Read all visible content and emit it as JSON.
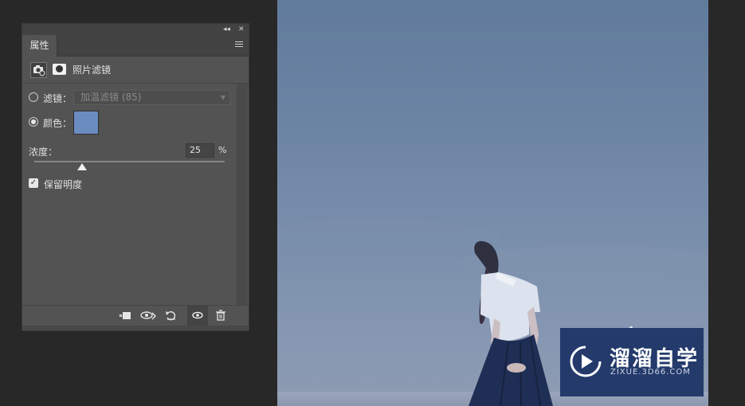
{
  "panel": {
    "tab_label": "属性",
    "header_title": "照片滤镜",
    "filter_label": "滤镜：",
    "filter_value": "加温滤镜 (85)",
    "color_label": "颜色：",
    "color_value": "#6a8cc0",
    "density_label": "浓度：",
    "density_value": "25",
    "density_unit": "%",
    "density_fraction": 0.25,
    "preserve_label": "保留明度",
    "preserve_checked": true,
    "selected_option": "color"
  },
  "icons": {
    "collapse": "double-left-arrow-icon",
    "close": "close-icon",
    "menu": "panel-menu-icon",
    "camera": "camera-adjustment-icon",
    "mask": "mask-icon",
    "clip": "clip-to-layer-icon",
    "view_previous": "view-previous-state-icon",
    "reset": "reset-icon",
    "visibility": "eye-icon",
    "delete": "trash-icon"
  },
  "watermark": {
    "title": "溜溜自学",
    "url": "ZIXUE.3D66.COM"
  }
}
